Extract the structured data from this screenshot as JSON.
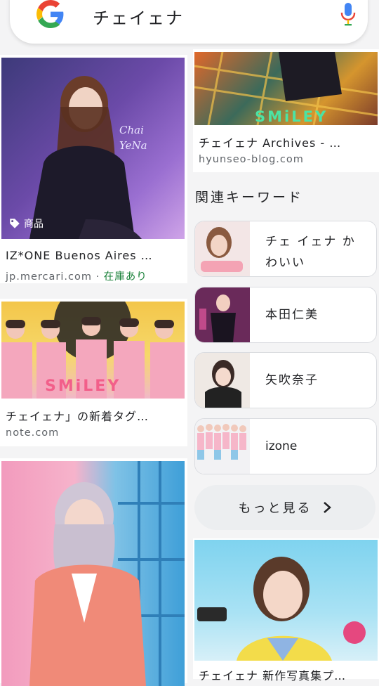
{
  "search": {
    "query": "チェイェナ"
  },
  "results_left": [
    {
      "title": "IZ*ONE Buenos Aires …",
      "source": "jp.mercari.com",
      "stock": "在庫あり",
      "badge": "商品",
      "image_text": "Chai YeNa"
    },
    {
      "title": "チェイェナ」の新着タグ…",
      "source": "note.com",
      "image_text": "SMiLEY"
    },
    {
      "title": "",
      "source": ""
    }
  ],
  "results_right": [
    {
      "title": "チェイェナ Archives - …",
      "source": "hyunseo-blog.com",
      "image_text": "SMiLEY"
    },
    {
      "title": "",
      "source": ""
    }
  ],
  "related": {
    "title": "関連キーワード",
    "items": [
      {
        "label_line1": "チェ イェナ か",
        "label_line2": "わいい"
      },
      {
        "label": "本田仁美"
      },
      {
        "label": "矢吹奈子"
      },
      {
        "label": "izone"
      }
    ],
    "more_label": "もっと見る"
  },
  "partial_bottom_text": "チェイェナ 新作写真集プ…",
  "colors": {
    "stock_green": "#188038",
    "accent_blue": "#4285F4"
  },
  "icons": [
    "google-logo-icon",
    "mic-icon",
    "tag-icon",
    "chevron-right-icon"
  ]
}
